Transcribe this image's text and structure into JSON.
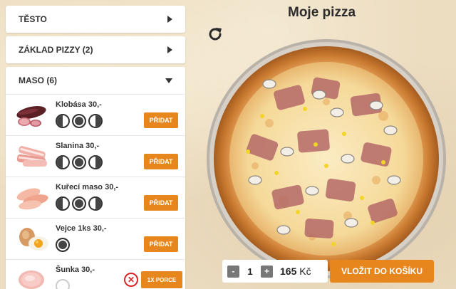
{
  "categories": [
    {
      "label": "TĚSTO",
      "state": "collapsed"
    },
    {
      "label": "ZÁKLAD PIZZY (2)",
      "state": "collapsed"
    },
    {
      "label": "MASO (6)",
      "state": "expanded"
    }
  ],
  "items": [
    {
      "name": "Klobása 30,-",
      "icon": "sausage-icon",
      "add_label": "PŘIDAT"
    },
    {
      "name": "Slanina 30,-",
      "icon": "bacon-icon",
      "add_label": "PŘIDAT"
    },
    {
      "name": "Kuřecí maso 30,-",
      "icon": "chicken-icon",
      "add_label": "PŘIDAT"
    },
    {
      "name": "Vejce 1ks 30,-",
      "icon": "egg-icon",
      "add_label": "PŘIDAT"
    },
    {
      "name": "Šunka 30,-",
      "icon": "ham-icon",
      "portion_label": "1X PORCE",
      "remove_label": "✕"
    }
  ],
  "pizza": {
    "title": "Moje pizza"
  },
  "cart": {
    "minus": "-",
    "quantity": "1",
    "plus": "+",
    "price": "165",
    "currency": "Kč",
    "button_label": "VLOŽIT DO KOŠÍKU"
  },
  "colors": {
    "accent": "#e8861e",
    "remove": "#d7262a",
    "background": "#ecdcc0"
  }
}
